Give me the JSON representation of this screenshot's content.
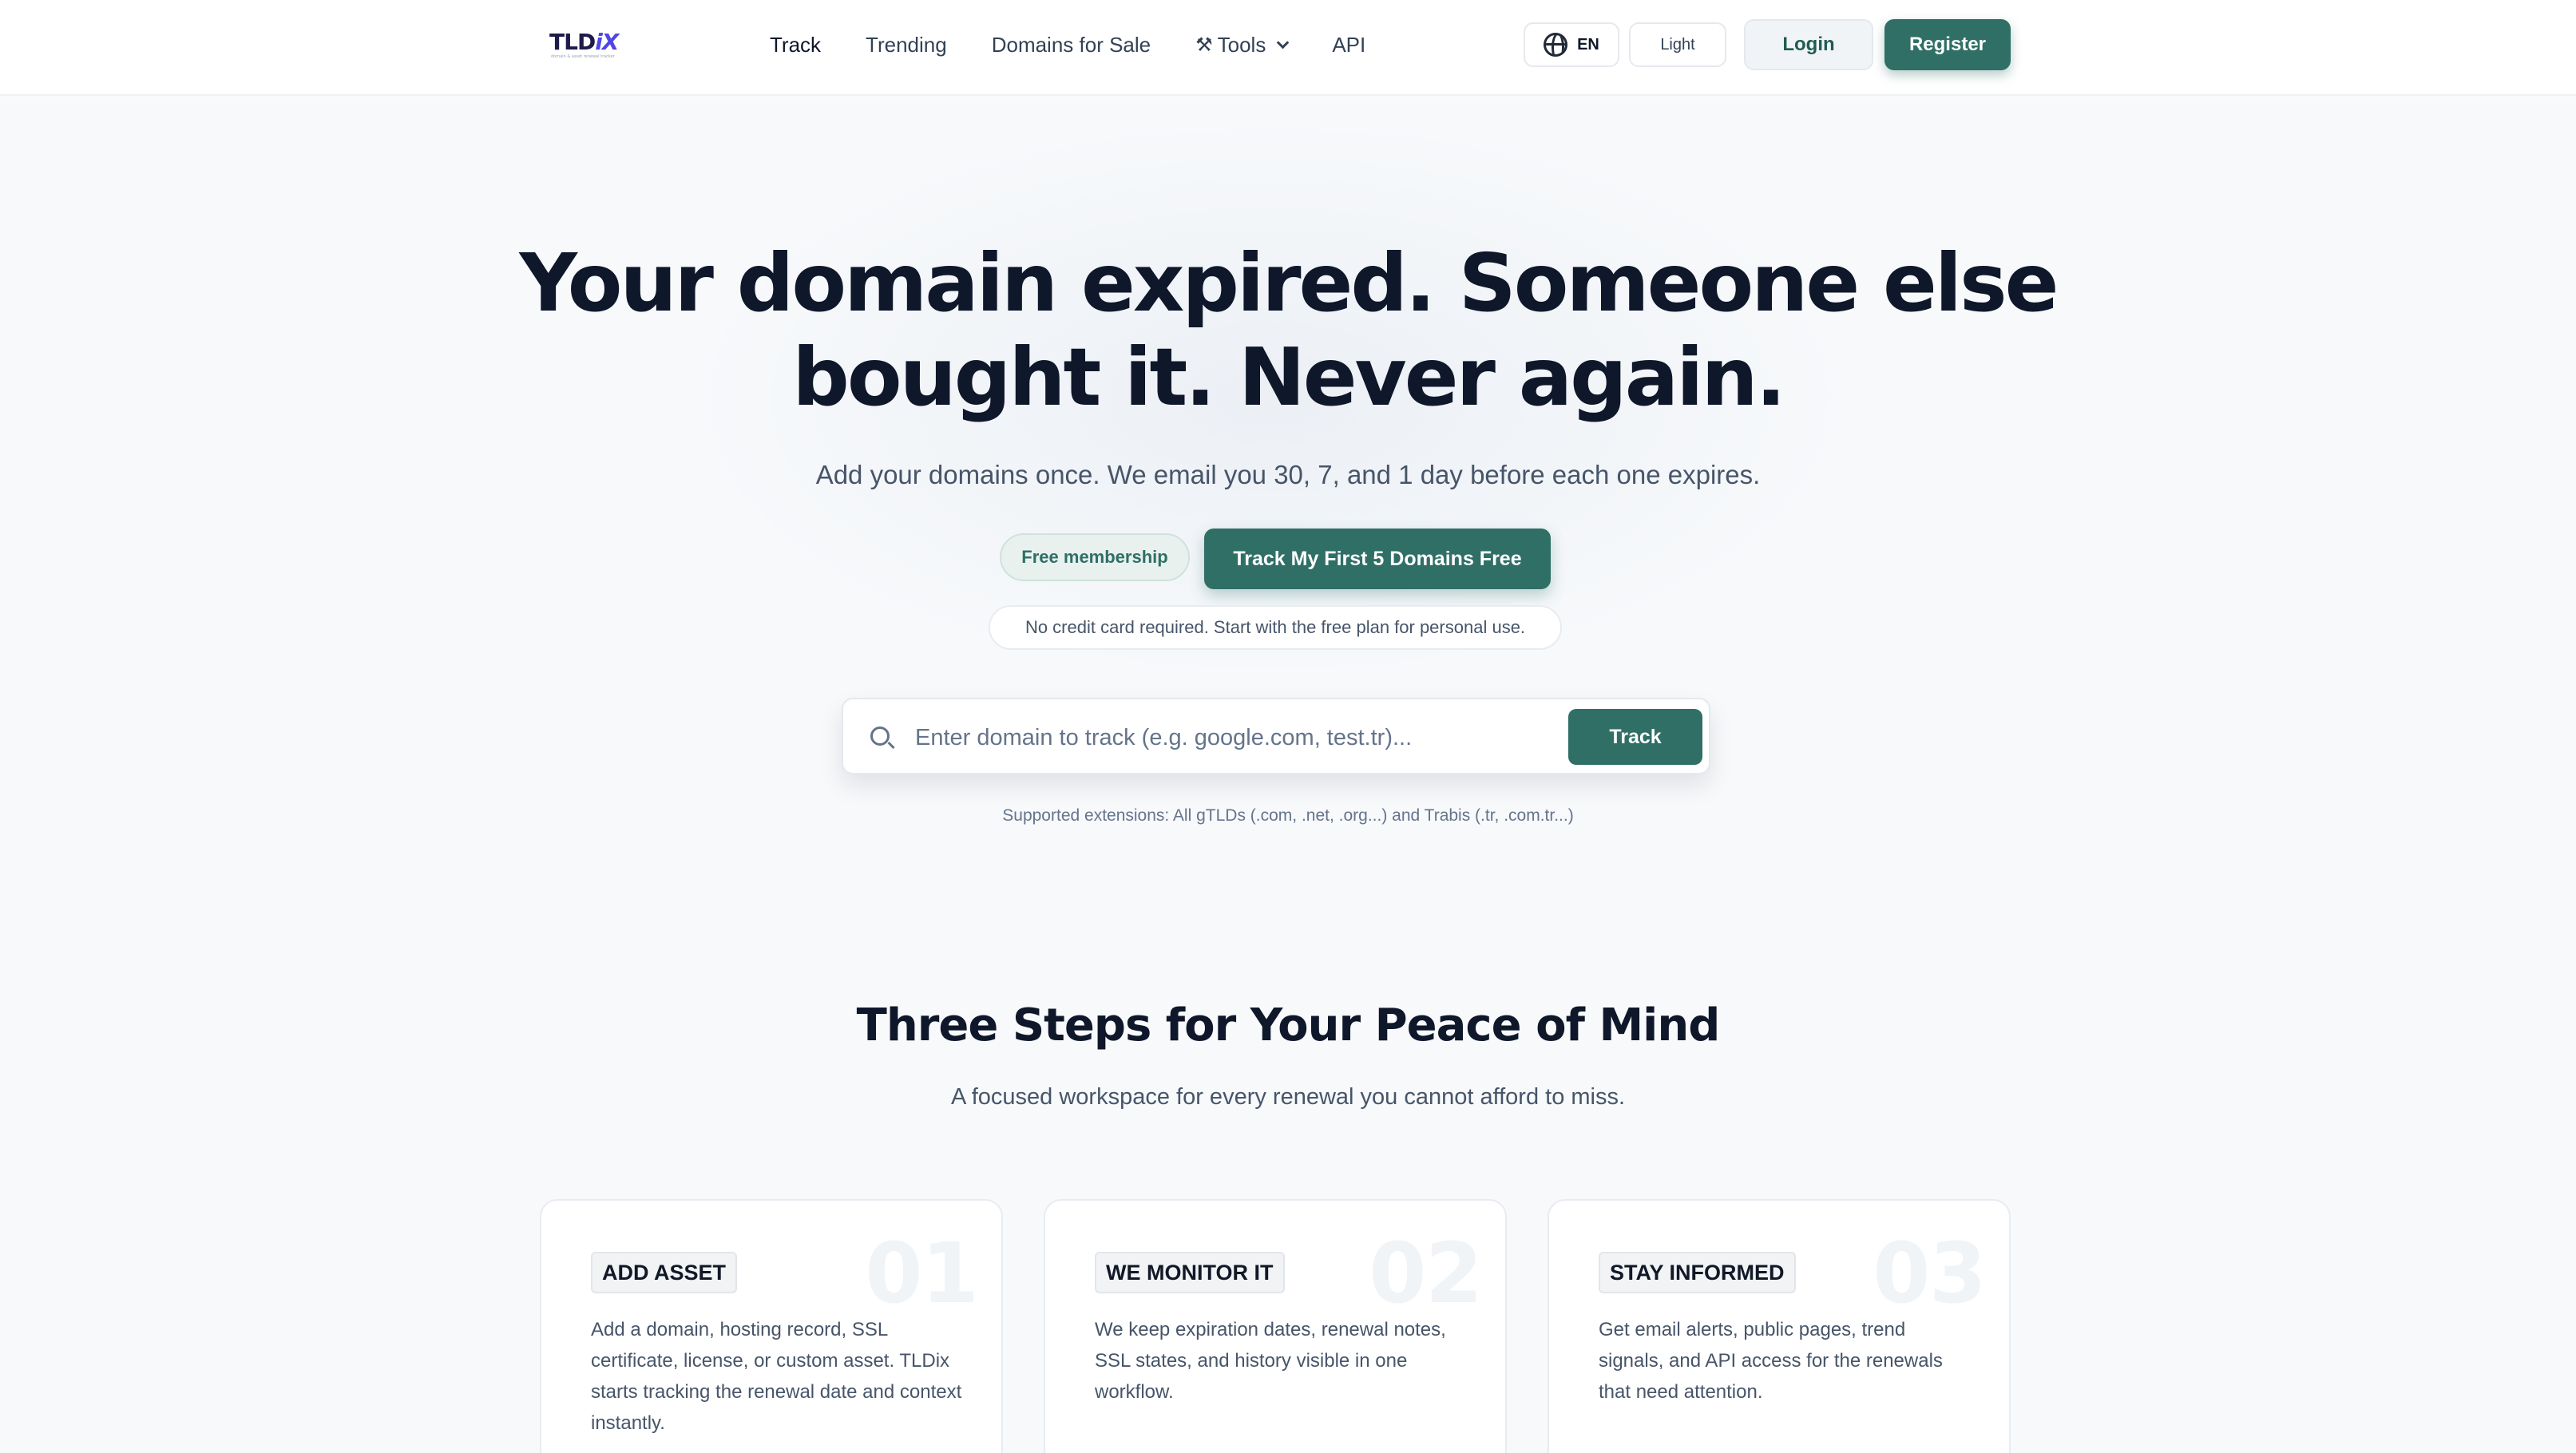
{
  "header": {
    "logo": {
      "main": "TLD",
      "accent": "iX",
      "tagline": "domain & asset renewal tracker"
    },
    "nav": [
      {
        "label": "Track"
      },
      {
        "label": "Trending"
      },
      {
        "label": "Domains for Sale"
      },
      {
        "label": "Tools"
      },
      {
        "label": "API"
      }
    ],
    "language": "EN",
    "theme": "Light",
    "login": "Login",
    "register": "Register"
  },
  "hero": {
    "title_line1": "Your domain expired. Someone else",
    "title_line2": "bought it. Never again.",
    "subtitle": "Add your domains once. We email you 30, 7, and 1 day before each one expires.",
    "free_pill": "Free membership",
    "cta": "Track My First 5 Domains Free",
    "note": "No credit card required. Start with the free plan for personal use.",
    "search": {
      "placeholder": "Enter domain to track (e.g. google.com, test.tr)...",
      "button": "Track"
    },
    "supported": "Supported extensions: All gTLDs (.com, .net, .org...) and Trabis (.tr, .com.tr...)"
  },
  "steps": {
    "title": "Three Steps for Your Peace of Mind",
    "subtitle": "A focused workspace for every renewal you cannot afford to miss.",
    "cards": [
      {
        "num": "01",
        "badge": "ADD ASSET",
        "desc": "Add a domain, hosting record, SSL certificate, license, or custom asset. TLDix starts tracking the renewal date and context instantly."
      },
      {
        "num": "02",
        "badge": "WE MONITOR IT",
        "desc": "We keep expiration dates, renewal notes, SSL states, and history visible in one workflow."
      },
      {
        "num": "03",
        "badge": "STAY INFORMED",
        "desc": "Get email alerts, public pages, trend signals, and API access for the renewals that need attention."
      }
    ]
  },
  "colors": {
    "primary": "#2f6f66",
    "background": "#f7f9fb",
    "text": "#0f172a"
  }
}
